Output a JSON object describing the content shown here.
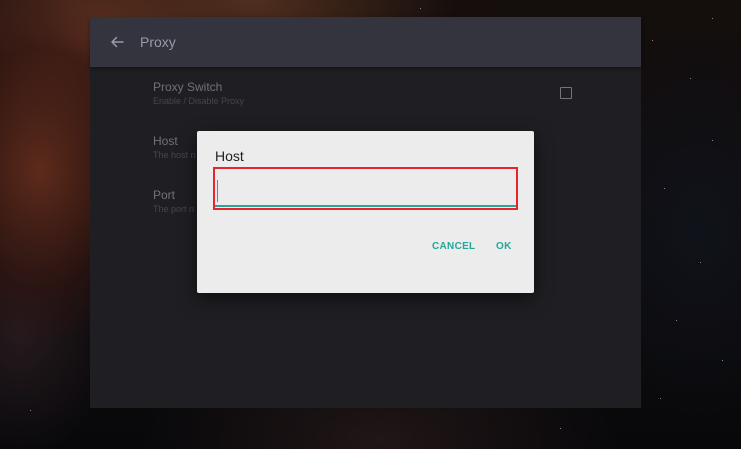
{
  "appbar": {
    "title": "Proxy",
    "back_icon": "arrow-left-icon"
  },
  "preferences": [
    {
      "title": "Proxy Switch",
      "summary": "Enable / Disable Proxy",
      "checked": false
    },
    {
      "title": "Host",
      "summary": "The host n"
    },
    {
      "title": "Port",
      "summary": "The port n"
    }
  ],
  "dialog": {
    "title": "Host",
    "input_value": "",
    "cancel_label": "CANCEL",
    "ok_label": "OK"
  },
  "colors": {
    "accent": "#26a69a",
    "highlight": "#e8252b",
    "appbar": "#34343e",
    "background": "#26262b",
    "dialog": "#ececec"
  }
}
